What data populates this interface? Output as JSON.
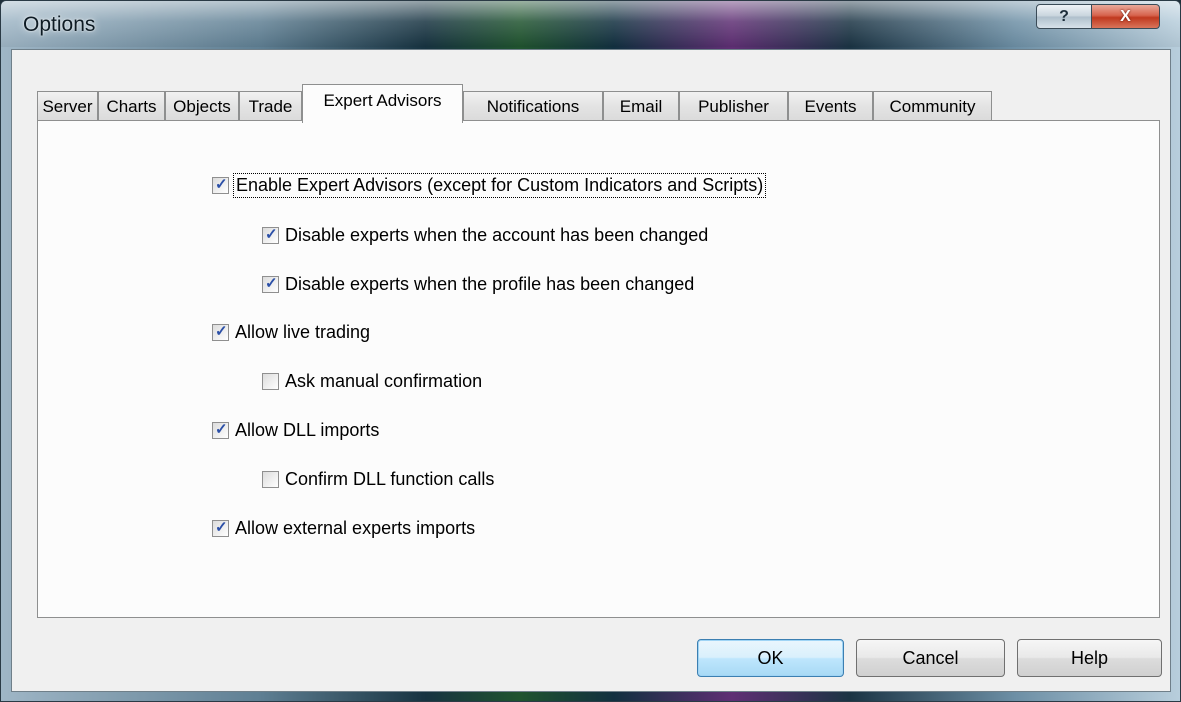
{
  "window": {
    "title": "Options"
  },
  "caption_buttons": {
    "help": "?",
    "close": "X"
  },
  "tabs": [
    {
      "label": "Server"
    },
    {
      "label": "Charts"
    },
    {
      "label": "Objects"
    },
    {
      "label": "Trade"
    },
    {
      "label": "Expert Advisors",
      "active": true
    },
    {
      "label": "Notifications"
    },
    {
      "label": "Email"
    },
    {
      "label": "Publisher"
    },
    {
      "label": "Events"
    },
    {
      "label": "Community"
    }
  ],
  "options": [
    {
      "label": "Enable Expert Advisors (except for Custom Indicators and Scripts)",
      "checked": true
    },
    {
      "label": "Disable experts when the account has been changed",
      "checked": true
    },
    {
      "label": "Disable experts when the profile has been changed",
      "checked": true
    },
    {
      "label": "Allow live trading",
      "checked": true
    },
    {
      "label": "Ask manual confirmation",
      "checked": false
    },
    {
      "label": "Allow DLL imports",
      "checked": true
    },
    {
      "label": "Confirm DLL function calls",
      "checked": false
    },
    {
      "label": "Allow external experts imports",
      "checked": true
    }
  ],
  "buttons": {
    "ok": "OK",
    "cancel": "Cancel",
    "help": "Help"
  },
  "colors": {
    "checkmark": "#2b4fa7",
    "default_button_border": "#3c7fb1"
  }
}
